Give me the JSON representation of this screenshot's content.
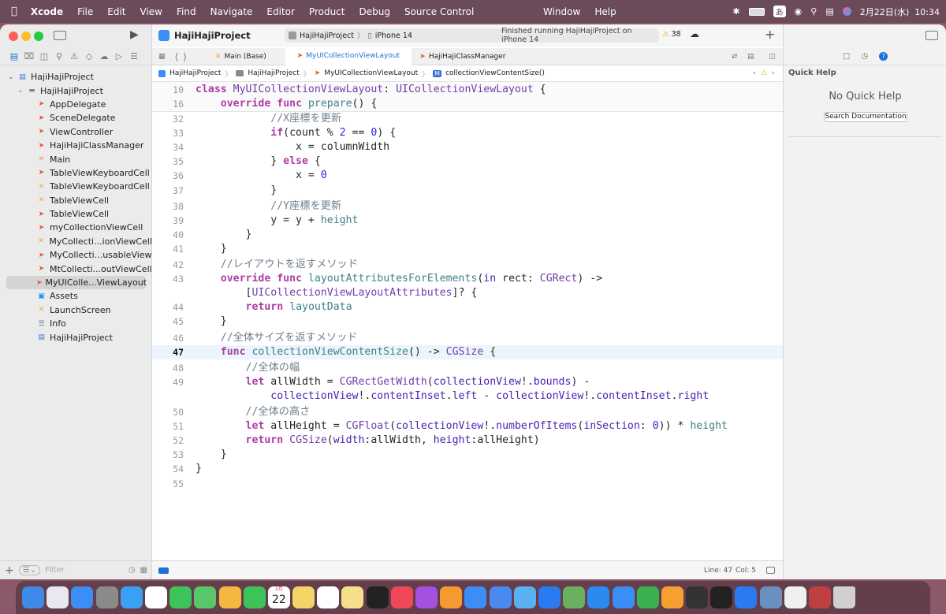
{
  "menubar": {
    "apple": "",
    "app": "Xcode",
    "items": [
      "File",
      "Edit",
      "View",
      "Find",
      "Navigate",
      "Editor",
      "Product",
      "Debug",
      "Source Control"
    ],
    "center_items": [
      "Window",
      "Help"
    ],
    "ime": "あ",
    "datetime": "2月22日(水)  10:34"
  },
  "toolbar": {
    "project": "HajiHajiProject",
    "scheme": "HajiHajiProject",
    "device": "iPhone 14",
    "status": "Finished running HajiHajiProject on iPhone 14",
    "warnings": "38",
    "add": "+"
  },
  "tabs": [
    {
      "label": "Main (Base)",
      "icon": "xib-icon",
      "active": false
    },
    {
      "label": "MyUICollectionViewLayout",
      "icon": "swift-icon",
      "active": true
    },
    {
      "label": "HajiHajiClassManager",
      "icon": "swift-icon",
      "active": false
    }
  ],
  "jumpbar": [
    "HajiHajiProject",
    "HajiHajiProject",
    "MyUICollectionViewLayout",
    "collectionViewContentSize()"
  ],
  "jumpbar_method_badge": "M",
  "navigator": {
    "items": [
      {
        "label": "HajiHajiProject",
        "type": "proj",
        "indent": 0,
        "disclosure": "⌄"
      },
      {
        "label": "HajiHajiProject",
        "type": "folder",
        "indent": 1,
        "disclosure": "⌄"
      },
      {
        "label": "AppDelegate",
        "type": "swift",
        "indent": 2
      },
      {
        "label": "SceneDelegate",
        "type": "swift",
        "indent": 2
      },
      {
        "label": "ViewController",
        "type": "swift",
        "indent": 2
      },
      {
        "label": "HajiHajiClassManager",
        "type": "swift",
        "indent": 2
      },
      {
        "label": "Main",
        "type": "xib",
        "indent": 2
      },
      {
        "label": "TableViewKeyboardCell",
        "type": "swift",
        "indent": 2
      },
      {
        "label": "TableViewKeyboardCell",
        "type": "xib",
        "indent": 2
      },
      {
        "label": "TableViewCell",
        "type": "xib",
        "indent": 2
      },
      {
        "label": "TableViewCell",
        "type": "swift",
        "indent": 2
      },
      {
        "label": "myCollectionViewCell",
        "type": "swift",
        "indent": 2
      },
      {
        "label": "MyCollecti...ionViewCell",
        "type": "xib",
        "indent": 2
      },
      {
        "label": "MyCollecti...usableView",
        "type": "swift",
        "indent": 2
      },
      {
        "label": "MtCollecti...outViewCell",
        "type": "swift",
        "indent": 2
      },
      {
        "label": "MyUIColle...ViewLayout",
        "type": "swift",
        "indent": 2,
        "selected": true
      },
      {
        "label": "Assets",
        "type": "asset",
        "indent": 2
      },
      {
        "label": "LaunchScreen",
        "type": "xib",
        "indent": 2
      },
      {
        "label": "Info",
        "type": "plist",
        "indent": 2
      },
      {
        "label": "HajiHajiProject",
        "type": "proj",
        "indent": 2
      }
    ],
    "filter_placeholder": "Filter",
    "add": "+"
  },
  "sticky": [
    {
      "num": "10",
      "html": "<span class='kw'>class</span> <span class='ty'>MyUICollectionViewLayout</span>: <span class='ty'>UICollectionViewLayout</span> {"
    },
    {
      "num": "16",
      "html": "    <span class='kw'>override</span> <span class='kw'>func</span> <span class='fn'>prepare</span>() {"
    }
  ],
  "code": [
    {
      "num": "32",
      "html": "            <span class='cm'>//X座標を更新</span>"
    },
    {
      "num": "33",
      "html": "            <span class='kw'>if</span>(count % <span class='nm'>2</span> == <span class='nm'>0</span>) {"
    },
    {
      "num": "34",
      "html": "                x = columnWidth"
    },
    {
      "num": "35",
      "html": "            } <span class='kw'>else</span> {"
    },
    {
      "num": "36",
      "html": "                x = <span class='nm'>0</span>"
    },
    {
      "num": "37",
      "html": "            }"
    },
    {
      "num": "38",
      "html": "            <span class='cm'>//Y座標を更新</span>"
    },
    {
      "num": "39",
      "html": "            y = y + <span class='fn'>height</span>"
    },
    {
      "num": "40",
      "html": "        }"
    },
    {
      "num": "41",
      "html": "    }"
    },
    {
      "num": "42",
      "html": "    <span class='cm'>//レイアウトを返すメソッド</span>"
    },
    {
      "num": "43",
      "html": "    <span class='kw'>override</span> <span class='kw'>func</span> <span class='fn'>layoutAttributesForElements</span>(<span class='prop'>in</span> rect: <span class='ty'>CGRect</span>) -&gt;"
    },
    {
      "num": "",
      "html": "        [<span class='ty'>UICollectionViewLayoutAttributes</span>]? {"
    },
    {
      "num": "44",
      "html": "        <span class='kw'>return</span> <span class='fn'>layoutData</span>"
    },
    {
      "num": "45",
      "html": "    }"
    },
    {
      "num": "46",
      "html": "    <span class='cm'>//全体サイズを返すメソッド</span>"
    },
    {
      "num": "47",
      "html": "    <span class='kw'>func</span> <span class='fn'>collectionViewContentSize</span>() -&gt; <span class='ty'>CGSize</span> {",
      "current": true
    },
    {
      "num": "48",
      "html": "        <span class='cm'>//全体の幅</span>"
    },
    {
      "num": "49",
      "html": "        <span class='kw'>let</span> allWidth = <span class='ty'>CGRectGetWidth</span>(<span class='prop'>collectionView</span>!.<span class='prop'>bounds</span>) -"
    },
    {
      "num": "",
      "html": "            <span class='prop'>collectionView</span>!.<span class='prop'>contentInset</span>.<span class='prop'>left</span> - <span class='prop'>collectionView</span>!.<span class='prop'>contentInset</span>.<span class='prop'>right</span>"
    },
    {
      "num": "50",
      "html": "        <span class='cm'>//全体の高さ</span>"
    },
    {
      "num": "51",
      "html": "        <span class='kw'>let</span> allHeight = <span class='ty'>CGFloat</span>(<span class='prop'>collectionView</span>!.<span class='prop'>numberOfItems</span>(<span class='prop'>inSection</span>: <span class='nm'>0</span>)) * <span class='fn'>height</span>"
    },
    {
      "num": "52",
      "html": "        <span class='kw'>return</span> <span class='ty'>CGSize</span>(<span class='prop'>width</span>:allWidth, <span class='prop'>height</span>:allHeight)"
    },
    {
      "num": "53",
      "html": "    }"
    },
    {
      "num": "54",
      "html": "}"
    },
    {
      "num": "55",
      "html": ""
    }
  ],
  "statusbar": {
    "line": "Line: 47",
    "col": "Col: 5"
  },
  "inspector": {
    "title": "Quick Help",
    "empty": "No Quick Help",
    "button": "Search Documentation"
  },
  "dock": {
    "calendar_month": "2月",
    "calendar_day": "22",
    "apps": [
      "Finder",
      "Launchpad",
      "Mail",
      "System Settings",
      "Safari",
      "Chrome",
      "Messages",
      "Maps",
      "Photos",
      "FaceTime",
      "Calendar",
      "Notes",
      "Reminders",
      "Stickies",
      "Apple TV",
      "Music",
      "Podcasts",
      "Books",
      "Xcode",
      "Simulator",
      "Kite",
      "App Store",
      "Text Editor",
      "VS Code",
      "Keynote",
      "Numbers",
      "Pages",
      "ChatGPT",
      "Terminal",
      "Zoom",
      "Preview",
      "TextEdit",
      "Dictionary",
      "Trash"
    ],
    "colors": [
      "#3d8ae8",
      "#e8e8f0",
      "#3a8ef5",
      "#8a8a8a",
      "#3aa0f5",
      "#ffffff",
      "#3cc45a",
      "#5ac66a",
      "#f4b840",
      "#3cc45a",
      "#ffffff",
      "#f4d468",
      "#ffffff",
      "#f4e08a",
      "#222222",
      "#f04858",
      "#a450e0",
      "#f59a30",
      "#3a8ef5",
      "#4a8af0",
      "#5ab0f0",
      "#2a7af0",
      "#6ab060",
      "#2a8af0",
      "#3a8ef5",
      "#3ab050",
      "#f5a030",
      "#333333",
      "#222222",
      "#2a7af0",
      "#6a90c0",
      "#f0f0f0",
      "#c04040",
      "#d0d0d0"
    ]
  }
}
